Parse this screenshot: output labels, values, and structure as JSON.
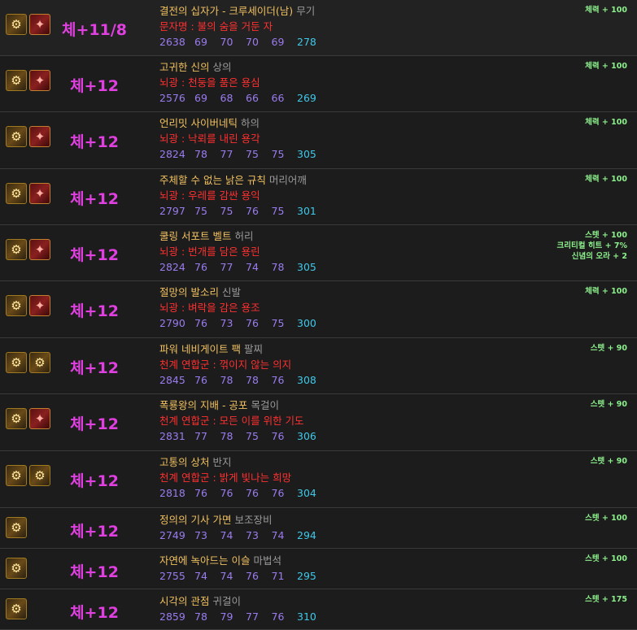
{
  "items": [
    {
      "icons": [
        "gear-icon",
        "red-gear-icon"
      ],
      "enhance": "체+11/8",
      "name": "결전의 십자가 - 크루세이더(남)",
      "slot": "무기",
      "sub": "문자명 : 불의 숨을 거둔 자",
      "stats": [
        "2638",
        "69",
        "70",
        "70",
        "69",
        "278"
      ],
      "bonus": [
        "체력 + 100"
      ]
    },
    {
      "icons": [
        "gear-icon",
        "red-gear-icon"
      ],
      "enhance": "체+12",
      "name": "고귀한 신의",
      "slot": "상의",
      "sub": "뇌광 : 천둥을 품은 용심",
      "stats": [
        "2576",
        "69",
        "68",
        "66",
        "66",
        "269"
      ],
      "bonus": [
        "체력 + 100"
      ]
    },
    {
      "icons": [
        "gear-icon",
        "red-gear-icon"
      ],
      "enhance": "체+12",
      "name": "언리밋 사이버네틱",
      "slot": "하의",
      "sub": "뇌광 : 낙뢰를 내린 용각",
      "stats": [
        "2824",
        "78",
        "77",
        "75",
        "75",
        "305"
      ],
      "bonus": [
        "체력 + 100"
      ]
    },
    {
      "icons": [
        "gear-icon",
        "red-gear-icon"
      ],
      "enhance": "체+12",
      "name": "주체할 수 없는 낡은 규칙",
      "slot": "머리어깨",
      "sub": "뇌광 : 우레를 감싼 용익",
      "stats": [
        "2797",
        "75",
        "75",
        "76",
        "75",
        "301"
      ],
      "bonus": [
        "체력 + 100"
      ]
    },
    {
      "icons": [
        "gear-icon",
        "red-gear-icon"
      ],
      "enhance": "체+12",
      "name": "쿨링 서포트 벨트",
      "slot": "허리",
      "sub": "뇌광 : 번개를 담은 용린",
      "stats": [
        "2824",
        "76",
        "77",
        "74",
        "78",
        "305"
      ],
      "bonus": [
        "스텟 + 100",
        "크리티컬 히트 + 7%",
        "신념의 오라 + 2"
      ]
    },
    {
      "icons": [
        "gear-icon",
        "red-gear-icon"
      ],
      "enhance": "체+12",
      "name": "절망의 발소리",
      "slot": "신발",
      "sub": "뇌광 : 벼락을 감은 용조",
      "stats": [
        "2790",
        "76",
        "73",
        "76",
        "75",
        "300"
      ],
      "bonus": [
        "체력 + 100"
      ]
    },
    {
      "icons": [
        "gear-icon",
        "gear-icon"
      ],
      "enhance": "체+12",
      "name": "파워 네비게이트 팩",
      "slot": "팔찌",
      "sub": "천계 연합군 : 꺾이지 않는 의지",
      "stats": [
        "2845",
        "76",
        "78",
        "78",
        "76",
        "308"
      ],
      "bonus": [
        "스텟 + 90"
      ]
    },
    {
      "icons": [
        "gear-icon",
        "red-gear-icon"
      ],
      "enhance": "체+12",
      "name": "폭룡왕의 지배 - 공포",
      "slot": "목걸이",
      "sub": "천계 연합군 : 모든 이를 위한 기도",
      "stats": [
        "2831",
        "77",
        "78",
        "75",
        "76",
        "306"
      ],
      "bonus": [
        "스텟 + 90"
      ]
    },
    {
      "icons": [
        "gear-icon",
        "gear-icon"
      ],
      "enhance": "체+12",
      "name": "고통의 상처",
      "slot": "반지",
      "sub": "천계 연합군 : 밝게 빛나는 희망",
      "stats": [
        "2818",
        "76",
        "76",
        "76",
        "76",
        "304"
      ],
      "bonus": [
        "스텟 + 90"
      ]
    },
    {
      "icons": [
        "gear-icon"
      ],
      "enhance": "체+12",
      "name": "정의의 기사 가면",
      "slot": "보조장비",
      "sub": "",
      "stats": [
        "2749",
        "73",
        "74",
        "73",
        "74",
        "294"
      ],
      "bonus": [
        "스텟 + 100"
      ]
    },
    {
      "icons": [
        "gear-icon"
      ],
      "enhance": "체+12",
      "name": "자연에 녹아드는 이슬",
      "slot": "마법석",
      "sub": "",
      "stats": [
        "2755",
        "74",
        "74",
        "76",
        "71",
        "295"
      ],
      "bonus": [
        "스텟 + 100"
      ]
    },
    {
      "icons": [
        "gear-icon"
      ],
      "enhance": "체+12",
      "name": "시각의 관점",
      "slot": "귀걸이",
      "sub": "",
      "stats": [
        "2859",
        "78",
        "79",
        "77",
        "76",
        "310"
      ],
      "bonus": [
        "스텟 + 175"
      ]
    }
  ]
}
